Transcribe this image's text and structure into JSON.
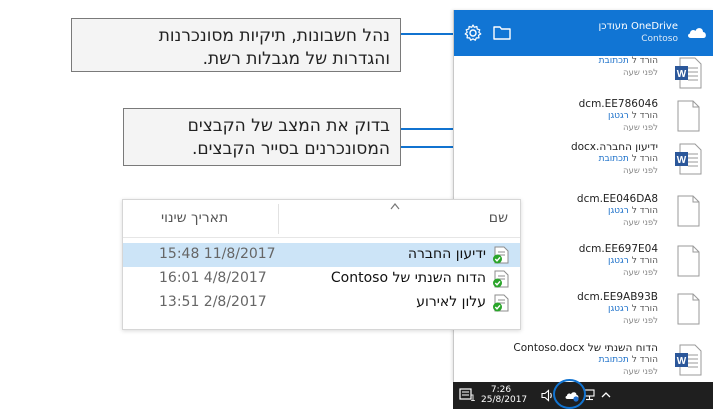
{
  "callouts": {
    "manage": {
      "line1": "נהל חשבונות, תיקיות מסונכרנות",
      "line2": "והגדרות של מגבלות רשת."
    },
    "status": {
      "line1": "בדוק את המצב של הקבצים",
      "line2": "המסונכרנים בסייר הקבצים."
    }
  },
  "onedrive_panel": {
    "title": "OneDrive מעודכן",
    "subtitle": "Contoso",
    "icons": [
      "gear-icon",
      "folder-icon",
      "cloud-icon"
    ],
    "files": [
      {
        "name": "",
        "action_prefix": "הורד ל",
        "action_link": "תכתובת",
        "time": "לפני שעה",
        "type": "word"
      },
      {
        "name": "dcm.EE786046",
        "action_prefix": "הורד ל",
        "action_link": "רגטגן",
        "time": "לפני שעה",
        "type": "blank"
      },
      {
        "name": "ידיעון החברה.docx",
        "action_prefix": "הורד ל",
        "action_link": "תכתובת",
        "time": "לפני שעה",
        "type": "word"
      },
      {
        "name": "dcm.EE046DA8",
        "action_prefix": "הורד ל",
        "action_link": "רגטגן",
        "time": "לפני שעה",
        "type": "blank"
      },
      {
        "name": "dcm.EE697E04",
        "action_prefix": "הורד ל",
        "action_link": "רגטגן",
        "time": "לפני שעה",
        "type": "blank"
      },
      {
        "name": "dcm.EE9AB93B",
        "action_prefix": "הורד ל",
        "action_link": "רגטגן",
        "time": "לפני שעה",
        "type": "blank"
      },
      {
        "name": "הדוח השנתי של Contoso.docx",
        "action_prefix": "הורד ל",
        "action_link": "תכתובת",
        "time": "לפני שעה",
        "type": "word"
      }
    ]
  },
  "taskbar": {
    "time": "7:26",
    "date": "25/8/2017",
    "notification_count": "1",
    "icons": [
      "notification-icon",
      "volume-icon",
      "onedrive-tray-icon",
      "network-icon",
      "chevron-up-icon"
    ]
  },
  "explorer": {
    "columns": {
      "name": "שם",
      "date_modified": "תאריך שינוי"
    },
    "rows": [
      {
        "name": "ידיעון החברה",
        "date": "15:48 11/8/2017",
        "selected": true
      },
      {
        "name": "הדוח השנתי של Contoso",
        "date": "16:01 4/8/2017",
        "selected": false
      },
      {
        "name": "עלון לאירוע",
        "date": "13:51 2/8/2017",
        "selected": false
      }
    ]
  },
  "colors": {
    "accent": "#1173d0",
    "header_blue": "#1175d4",
    "selected_row": "#cce4f7",
    "link": "#1a6fc9",
    "taskbar": "#1f1f1f",
    "sync_green": "#2aa52a"
  }
}
